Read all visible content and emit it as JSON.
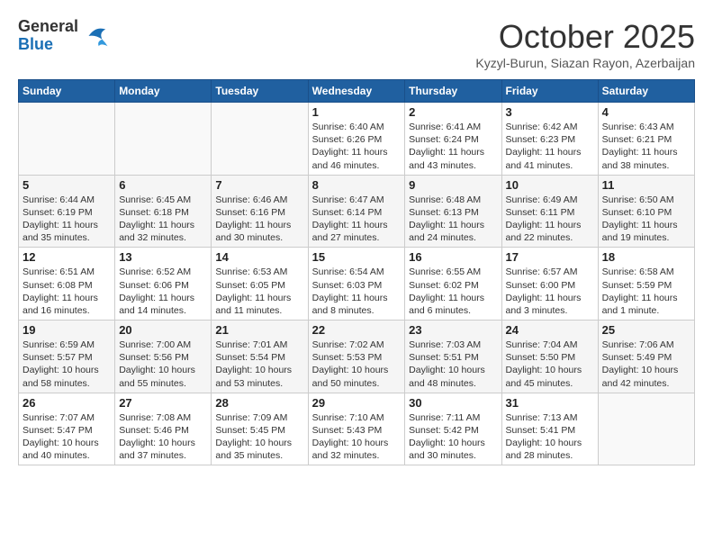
{
  "header": {
    "logo_general": "General",
    "logo_blue": "Blue",
    "month_year": "October 2025",
    "location": "Kyzyl-Burun, Siazan Rayon, Azerbaijan"
  },
  "days_of_week": [
    "Sunday",
    "Monday",
    "Tuesday",
    "Wednesday",
    "Thursday",
    "Friday",
    "Saturday"
  ],
  "weeks": [
    [
      {
        "day": "",
        "info": ""
      },
      {
        "day": "",
        "info": ""
      },
      {
        "day": "",
        "info": ""
      },
      {
        "day": "1",
        "info": "Sunrise: 6:40 AM\nSunset: 6:26 PM\nDaylight: 11 hours\nand 46 minutes."
      },
      {
        "day": "2",
        "info": "Sunrise: 6:41 AM\nSunset: 6:24 PM\nDaylight: 11 hours\nand 43 minutes."
      },
      {
        "day": "3",
        "info": "Sunrise: 6:42 AM\nSunset: 6:23 PM\nDaylight: 11 hours\nand 41 minutes."
      },
      {
        "day": "4",
        "info": "Sunrise: 6:43 AM\nSunset: 6:21 PM\nDaylight: 11 hours\nand 38 minutes."
      }
    ],
    [
      {
        "day": "5",
        "info": "Sunrise: 6:44 AM\nSunset: 6:19 PM\nDaylight: 11 hours\nand 35 minutes."
      },
      {
        "day": "6",
        "info": "Sunrise: 6:45 AM\nSunset: 6:18 PM\nDaylight: 11 hours\nand 32 minutes."
      },
      {
        "day": "7",
        "info": "Sunrise: 6:46 AM\nSunset: 6:16 PM\nDaylight: 11 hours\nand 30 minutes."
      },
      {
        "day": "8",
        "info": "Sunrise: 6:47 AM\nSunset: 6:14 PM\nDaylight: 11 hours\nand 27 minutes."
      },
      {
        "day": "9",
        "info": "Sunrise: 6:48 AM\nSunset: 6:13 PM\nDaylight: 11 hours\nand 24 minutes."
      },
      {
        "day": "10",
        "info": "Sunrise: 6:49 AM\nSunset: 6:11 PM\nDaylight: 11 hours\nand 22 minutes."
      },
      {
        "day": "11",
        "info": "Sunrise: 6:50 AM\nSunset: 6:10 PM\nDaylight: 11 hours\nand 19 minutes."
      }
    ],
    [
      {
        "day": "12",
        "info": "Sunrise: 6:51 AM\nSunset: 6:08 PM\nDaylight: 11 hours\nand 16 minutes."
      },
      {
        "day": "13",
        "info": "Sunrise: 6:52 AM\nSunset: 6:06 PM\nDaylight: 11 hours\nand 14 minutes."
      },
      {
        "day": "14",
        "info": "Sunrise: 6:53 AM\nSunset: 6:05 PM\nDaylight: 11 hours\nand 11 minutes."
      },
      {
        "day": "15",
        "info": "Sunrise: 6:54 AM\nSunset: 6:03 PM\nDaylight: 11 hours\nand 8 minutes."
      },
      {
        "day": "16",
        "info": "Sunrise: 6:55 AM\nSunset: 6:02 PM\nDaylight: 11 hours\nand 6 minutes."
      },
      {
        "day": "17",
        "info": "Sunrise: 6:57 AM\nSunset: 6:00 PM\nDaylight: 11 hours\nand 3 minutes."
      },
      {
        "day": "18",
        "info": "Sunrise: 6:58 AM\nSunset: 5:59 PM\nDaylight: 11 hours\nand 1 minute."
      }
    ],
    [
      {
        "day": "19",
        "info": "Sunrise: 6:59 AM\nSunset: 5:57 PM\nDaylight: 10 hours\nand 58 minutes."
      },
      {
        "day": "20",
        "info": "Sunrise: 7:00 AM\nSunset: 5:56 PM\nDaylight: 10 hours\nand 55 minutes."
      },
      {
        "day": "21",
        "info": "Sunrise: 7:01 AM\nSunset: 5:54 PM\nDaylight: 10 hours\nand 53 minutes."
      },
      {
        "day": "22",
        "info": "Sunrise: 7:02 AM\nSunset: 5:53 PM\nDaylight: 10 hours\nand 50 minutes."
      },
      {
        "day": "23",
        "info": "Sunrise: 7:03 AM\nSunset: 5:51 PM\nDaylight: 10 hours\nand 48 minutes."
      },
      {
        "day": "24",
        "info": "Sunrise: 7:04 AM\nSunset: 5:50 PM\nDaylight: 10 hours\nand 45 minutes."
      },
      {
        "day": "25",
        "info": "Sunrise: 7:06 AM\nSunset: 5:49 PM\nDaylight: 10 hours\nand 42 minutes."
      }
    ],
    [
      {
        "day": "26",
        "info": "Sunrise: 7:07 AM\nSunset: 5:47 PM\nDaylight: 10 hours\nand 40 minutes."
      },
      {
        "day": "27",
        "info": "Sunrise: 7:08 AM\nSunset: 5:46 PM\nDaylight: 10 hours\nand 37 minutes."
      },
      {
        "day": "28",
        "info": "Sunrise: 7:09 AM\nSunset: 5:45 PM\nDaylight: 10 hours\nand 35 minutes."
      },
      {
        "day": "29",
        "info": "Sunrise: 7:10 AM\nSunset: 5:43 PM\nDaylight: 10 hours\nand 32 minutes."
      },
      {
        "day": "30",
        "info": "Sunrise: 7:11 AM\nSunset: 5:42 PM\nDaylight: 10 hours\nand 30 minutes."
      },
      {
        "day": "31",
        "info": "Sunrise: 7:13 AM\nSunset: 5:41 PM\nDaylight: 10 hours\nand 28 minutes."
      },
      {
        "day": "",
        "info": ""
      }
    ]
  ]
}
